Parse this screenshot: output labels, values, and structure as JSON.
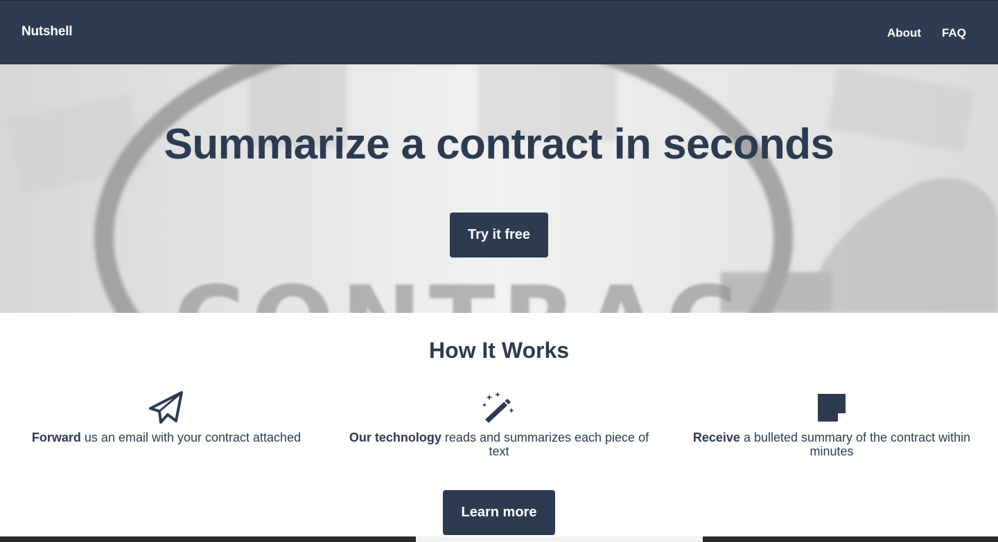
{
  "navbar": {
    "brand": "Nutshell",
    "links": [
      "About",
      "FAQ"
    ]
  },
  "hero": {
    "title": "Summarize a contract in seconds",
    "cta_label": "Try it free",
    "background_word": "CONTRAC"
  },
  "how_it_works": {
    "title": "How It Works",
    "steps": [
      {
        "icon": "paper-plane-icon",
        "bold": "Forward",
        "rest": " us an email with your contract attached"
      },
      {
        "icon": "magic-wand-icon",
        "bold": "Our technology",
        "rest": " reads and summarizes each piece of text"
      },
      {
        "icon": "sticky-note-icon",
        "bold": "Receive",
        "rest": " a bulleted summary of the contract within minutes"
      }
    ],
    "cta_label": "Learn more"
  },
  "colors": {
    "primary": "#2c3b50",
    "navbar": "#2d3c52",
    "text_on_primary": "#ffffff",
    "content_background": "#ffffff"
  }
}
